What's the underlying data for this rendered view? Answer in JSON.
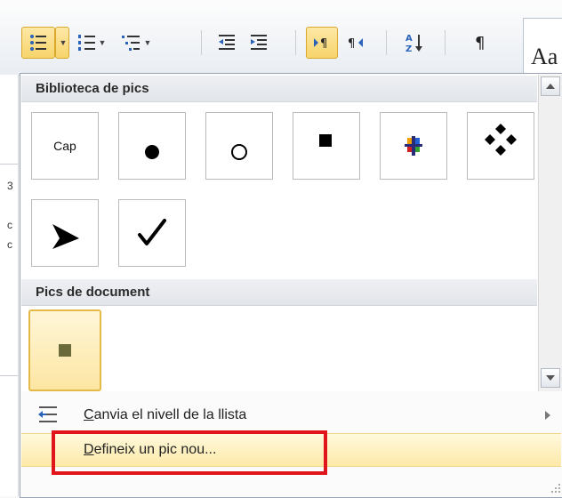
{
  "toolbar": {
    "styles_preview": "Aa"
  },
  "menu": {
    "section_library": "Biblioteca de pics",
    "section_document": "Pics de document",
    "library_tiles": [
      {
        "label": "Cap",
        "icon": "none-text"
      },
      {
        "icon": "filled-circle"
      },
      {
        "icon": "hollow-circle"
      },
      {
        "icon": "filled-square"
      },
      {
        "icon": "four-color-diamond"
      },
      {
        "icon": "four-diamond-cluster"
      },
      {
        "icon": "arrowhead"
      },
      {
        "icon": "checkmark"
      }
    ],
    "document_tiles": [
      {
        "icon": "olive-square"
      }
    ],
    "change_level_label_first": "C",
    "change_level_label_rest": "anvia el nivell de la llista",
    "define_new_label_first": "D",
    "define_new_label_rest": "efineix un pic nou..."
  },
  "document_fragment": {
    "chars": [
      "3",
      "c",
      "c"
    ]
  },
  "colors": {
    "selection_gold": "#fde6a3",
    "highlight_red": "#e0151c",
    "bullet_olive": "#6b6a3a"
  }
}
